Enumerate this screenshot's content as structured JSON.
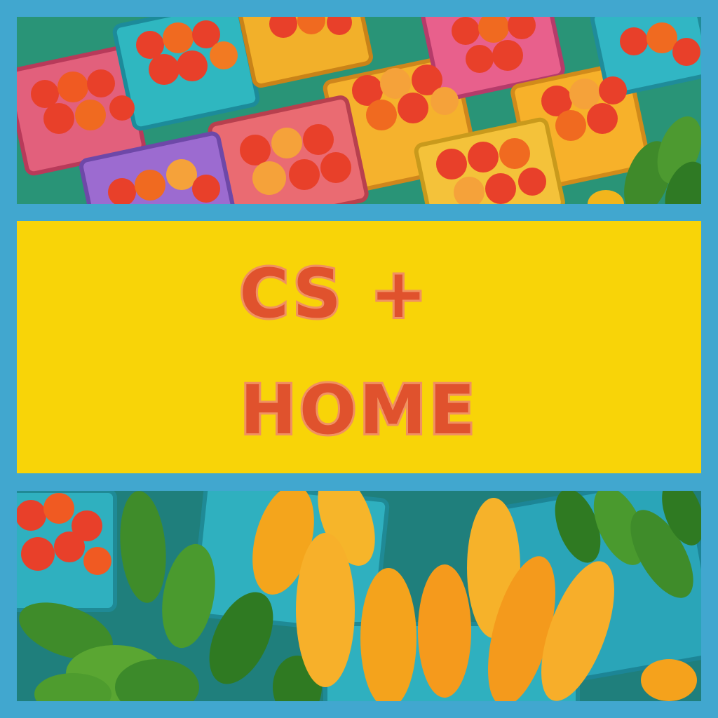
{
  "title": {
    "line1": "CS +",
    "line2": "HOME"
  },
  "colors": {
    "border": "#41a7cf",
    "band": "#f8d408",
    "title_text": "#e0522d",
    "title_outline": "#f09060"
  },
  "images": {
    "top": "painting-tomato-baskets",
    "bottom": "painting-cucumbers-and-yellow-squash"
  }
}
